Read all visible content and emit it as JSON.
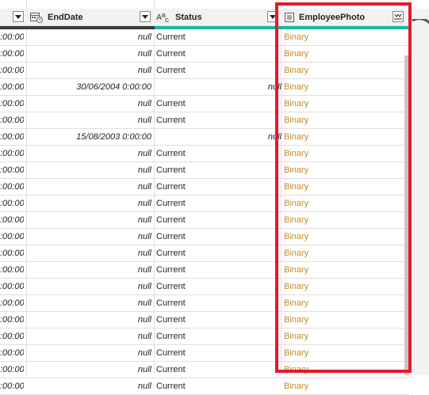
{
  "columns": [
    {
      "name": "",
      "type_icon": "chevron-down-icon"
    },
    {
      "name": "EndDate",
      "type_icon": "calendar-clock-icon"
    },
    {
      "name": "Status",
      "type_icon": "abc-text-icon"
    },
    {
      "name": "EmployeePhoto",
      "type_icon": "table-icon",
      "expand_icon": "expand-columns-icon"
    }
  ],
  "rows": [
    {
      "time": ":00:00",
      "end_date": "null",
      "status": "Current",
      "photo": "Binary"
    },
    {
      "time": ":00:00",
      "end_date": "null",
      "status": "Current",
      "photo": "Binary"
    },
    {
      "time": ":00:00",
      "end_date": "null",
      "status": "Current",
      "photo": "Binary"
    },
    {
      "time": ":00:00",
      "end_date": "30/06/2004 0:00:00",
      "status": "null",
      "photo": "Binary"
    },
    {
      "time": ":00:00",
      "end_date": "null",
      "status": "Current",
      "photo": "Binary"
    },
    {
      "time": ":00:00",
      "end_date": "null",
      "status": "Current",
      "photo": "Binary"
    },
    {
      "time": ":00:00",
      "end_date": "15/08/2003 0:00:00",
      "status": "null",
      "photo": "Binary"
    },
    {
      "time": ":00:00",
      "end_date": "null",
      "status": "Current",
      "photo": "Binary"
    },
    {
      "time": ":00:00",
      "end_date": "null",
      "status": "Current",
      "photo": "Binary"
    },
    {
      "time": ":00:00",
      "end_date": "null",
      "status": "Current",
      "photo": "Binary"
    },
    {
      "time": ":00:00",
      "end_date": "null",
      "status": "Current",
      "photo": "Binary"
    },
    {
      "time": ":00:00",
      "end_date": "null",
      "status": "Current",
      "photo": "Binary"
    },
    {
      "time": ":00:00",
      "end_date": "null",
      "status": "Current",
      "photo": "Binary"
    },
    {
      "time": ":00:00",
      "end_date": "null",
      "status": "Current",
      "photo": "Binary"
    },
    {
      "time": ":00:00",
      "end_date": "null",
      "status": "Current",
      "photo": "Binary"
    },
    {
      "time": ":00:00",
      "end_date": "null",
      "status": "Current",
      "photo": "Binary"
    },
    {
      "time": ":00:00",
      "end_date": "null",
      "status": "Current",
      "photo": "Binary"
    },
    {
      "time": ":00:00",
      "end_date": "null",
      "status": "Current",
      "photo": "Binary"
    },
    {
      "time": ":00:00",
      "end_date": "null",
      "status": "Current",
      "photo": "Binary"
    },
    {
      "time": ":00:00",
      "end_date": "null",
      "status": "Current",
      "photo": "Binary"
    },
    {
      "time": ":00:00",
      "end_date": "null",
      "status": "Current",
      "photo": "Binary"
    },
    {
      "time": ":00:00",
      "end_date": "null",
      "status": "Current",
      "photo": "Binary"
    }
  ],
  "colors": {
    "quality_bar": "#1ab5a5",
    "binary_text": "#c28a2e",
    "highlight": "#e21b2b"
  }
}
